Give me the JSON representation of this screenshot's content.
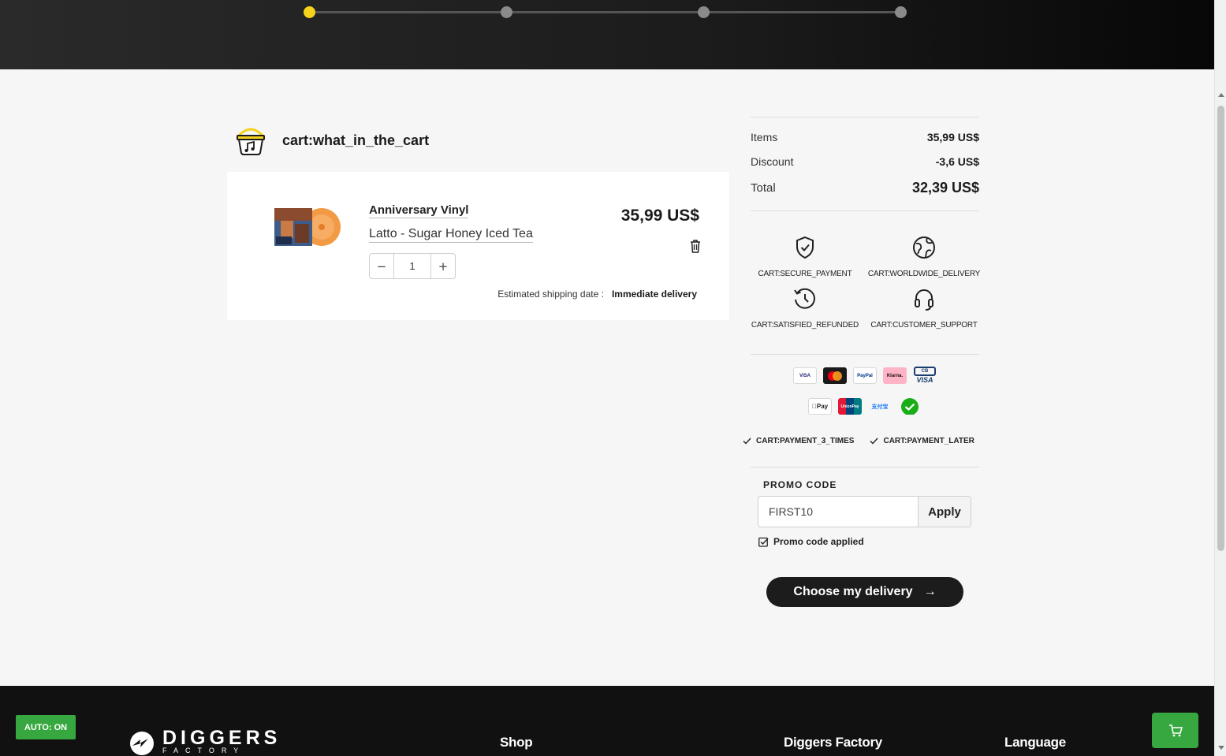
{
  "stepper": {
    "steps": 4,
    "active_step": 1
  },
  "cart": {
    "title": "cart:what_in_the_cart",
    "item": {
      "type": "Anniversary Vinyl",
      "title": "Latto - Sugar Honey Iced Tea",
      "price": "35,99 US$",
      "quantity": "1",
      "decrement": "−",
      "increment": "+",
      "shipping_label": "Estimated shipping date :",
      "shipping_value": "Immediate delivery"
    }
  },
  "summary": {
    "items_label": "Items",
    "items_value": "35,99 US$",
    "discount_label": "Discount",
    "discount_value": "-3,6 US$",
    "total_label": "Total",
    "total_value": "32,39 US$"
  },
  "features": [
    {
      "label": "CART:SECURE_PAYMENT",
      "icon": "shield-check-icon"
    },
    {
      "label": "CART:WORLDWIDE_DELIVERY",
      "icon": "globe-icon"
    },
    {
      "label": "CART:SATISFIED_REFUNDED",
      "icon": "history-icon"
    },
    {
      "label": "CART:CUSTOMER_SUPPORT",
      "icon": "headset-icon"
    }
  ],
  "payment_logos": {
    "visa": "VISA",
    "mastercard": "mastercard",
    "paypal": "PayPal",
    "klarna": "Klarna.",
    "cb": "CB",
    "cb_visa": "VISA",
    "applepay": "Pay",
    "unionpay": "UnionPay",
    "alipay": "支付宝",
    "wechat": ""
  },
  "payment_options": [
    "CART:PAYMENT_3_TIMES",
    "CART:PAYMENT_LATER"
  ],
  "promo": {
    "label": "PROMO CODE",
    "value": "FIRST10",
    "apply": "Apply",
    "applied": "Promo code applied"
  },
  "cta": {
    "label": "Choose my delivery",
    "arrow": "→"
  },
  "footer": {
    "auto_button": "AUTO: ON",
    "logo_main": "DIGGERS",
    "logo_sub": "FACTORY",
    "columns": [
      "Shop",
      "Diggers Factory",
      "Language"
    ]
  },
  "colors": {
    "accent": "#f5d31c",
    "green": "#37a83f",
    "dark": "#1c1c1c"
  }
}
